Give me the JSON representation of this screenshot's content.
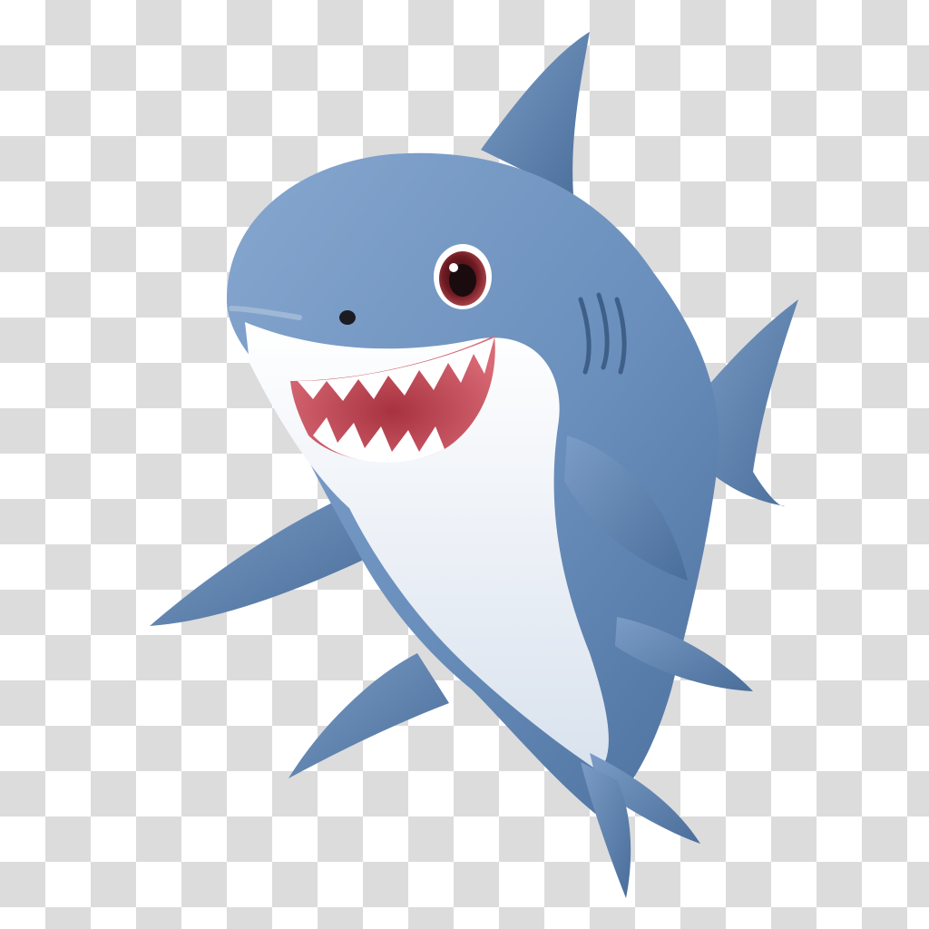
{
  "scene": {
    "subject": "shark",
    "background": "transparency-checkerboard"
  },
  "colors": {
    "checker_light": "#ffffff",
    "checker_dark": "#dcdcdc",
    "body_blue": "#6e93bf",
    "body_dark": "#4a6f9c",
    "fin_blue": "#5b80ad",
    "belly": "#eef2f7",
    "mouth": "#c24a57",
    "teeth": "#ffffff",
    "eye_iris": "#7a1e24",
    "eye_pupil": "#1a0c0e"
  }
}
